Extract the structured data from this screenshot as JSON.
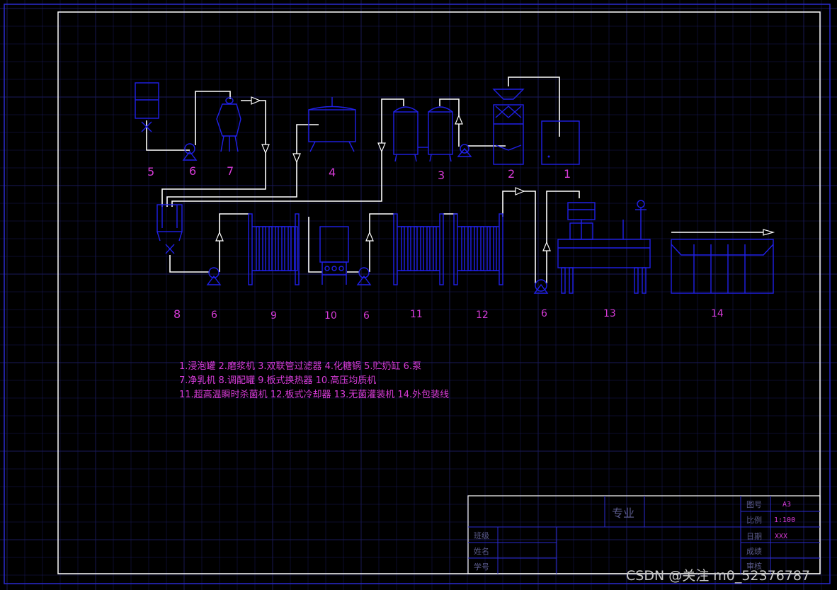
{
  "equipment_numbers": {
    "n1": "1",
    "n2": "2",
    "n3": "3",
    "n4": "4",
    "n5": "5",
    "n6a": "6",
    "n7": "7",
    "n8": "8",
    "n6b": "6",
    "n9": "9",
    "n10": "10",
    "n6c": "6",
    "n11": "11",
    "n12": "12",
    "n6d": "6",
    "n13": "13",
    "n14": "14"
  },
  "legend": {
    "line1": "1.浸泡罐 2.磨浆机 3.双联管过滤器 4.化糖锅 5.贮奶缸 6.泵",
    "line2": "7.净乳机 8.调配罐 9.板式换热器 10.高压均质机",
    "line3": "11.超高温瞬时杀菌机 12.板式冷却器 13.无菌灌装机 14.外包装线"
  },
  "title_block": {
    "major_label": "专业",
    "drawing_no_label": "图号",
    "drawing_no_value": "A3",
    "scale_label": "比例",
    "scale_value": "1:100",
    "date_label": "日期",
    "date_value": "XXX",
    "score_label": "成绩",
    "review_label": "审核",
    "class_label": "班级",
    "name_label": "姓名",
    "student_id_label": "学号"
  },
  "watermark": "CSDN @关注 m0_52376787",
  "colors": {
    "background": "#000000",
    "equipment": "#2020e8",
    "pipe": "#ffffff",
    "label": "#d63bd6",
    "grid": "#1a1a5a"
  }
}
